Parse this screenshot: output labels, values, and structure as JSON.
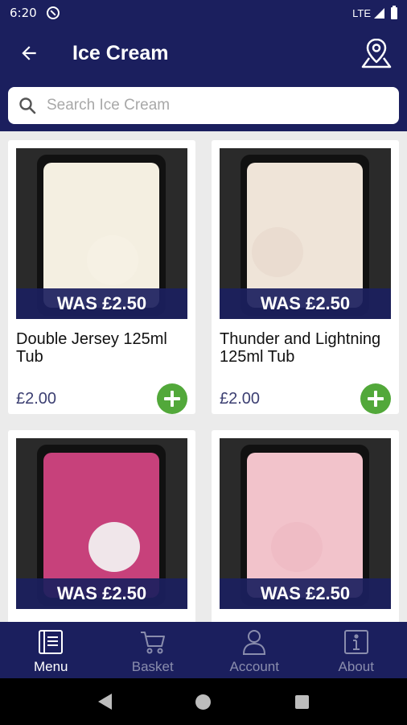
{
  "status_bar": {
    "time": "6:20",
    "network": "LTE"
  },
  "header": {
    "title": "Ice Cream"
  },
  "search": {
    "placeholder": "Search Ice Cream"
  },
  "products": [
    {
      "name": "Double Jersey 125ml Tub",
      "price": "£2.00",
      "was": "WAS £2.50",
      "cream_color": "#f4efe1",
      "scoop_color": "#f6f1e4"
    },
    {
      "name": "Thunder and Lightning 125ml Tub",
      "price": "£2.00",
      "was": "WAS £2.50",
      "cream_color": "#efe4d8",
      "scoop_color": "#eadcd0"
    },
    {
      "name": "",
      "price": "",
      "was": "WAS £2.50",
      "cream_color": "#c7417b",
      "scoop_color": "#f0e6ea"
    },
    {
      "name": "",
      "price": "",
      "was": "WAS £2.50",
      "cream_color": "#f2c3cb",
      "scoop_color": "#efbcc5"
    }
  ],
  "bottom_nav": [
    {
      "label": "Menu",
      "icon": "menu-book-icon",
      "active": true
    },
    {
      "label": "Basket",
      "icon": "cart-icon",
      "active": false
    },
    {
      "label": "Account",
      "icon": "account-icon",
      "active": false
    },
    {
      "label": "About",
      "icon": "info-icon",
      "active": false
    }
  ],
  "colors": {
    "brand": "#1b1f5e",
    "add_button": "#52a83a",
    "price": "#3c3f72"
  }
}
